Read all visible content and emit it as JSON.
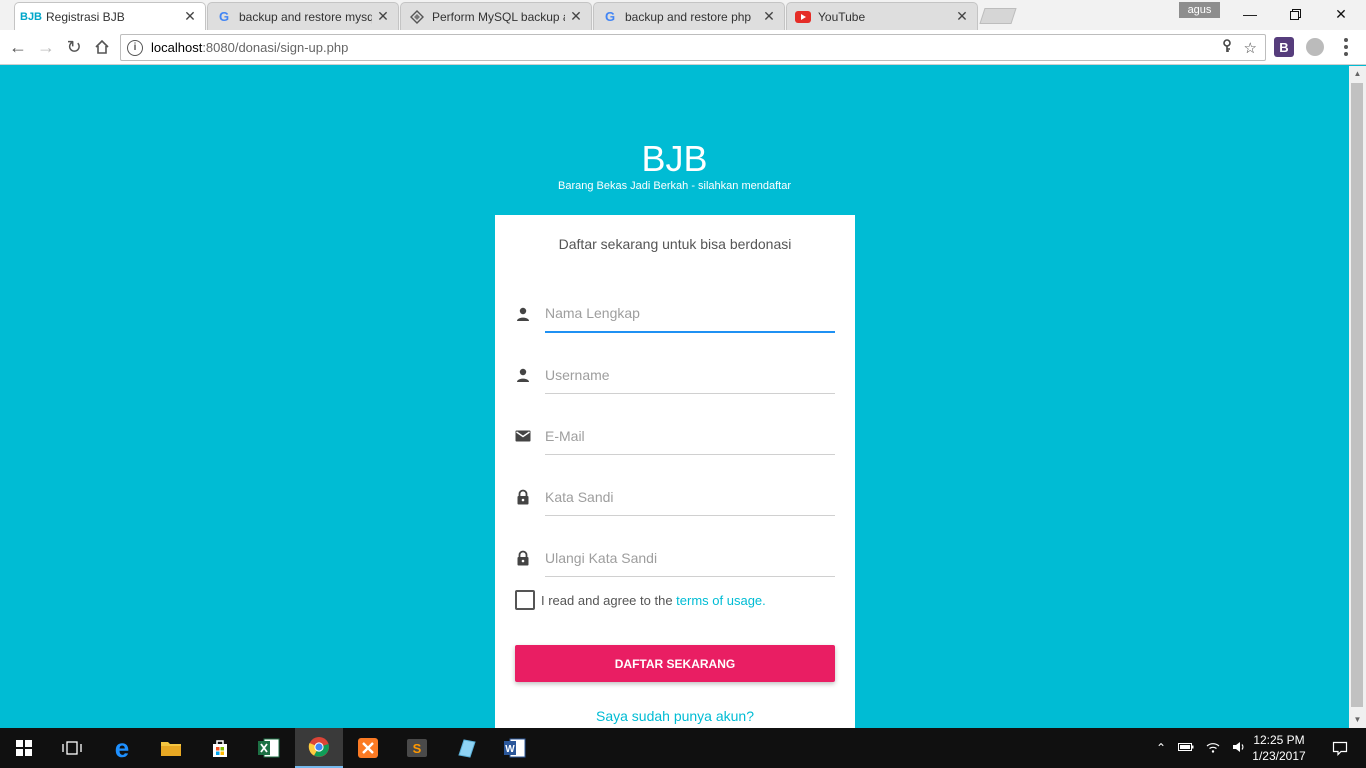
{
  "browser": {
    "tabs": [
      {
        "title": "Registrasi BJB",
        "favicon": "bjb-logo-icon"
      },
      {
        "title": "backup and restore mysql",
        "favicon": "google-icon"
      },
      {
        "title": "Perform MySQL backup and",
        "favicon": "mysql-icon"
      },
      {
        "title": "backup and restore php",
        "favicon": "google-icon"
      },
      {
        "title": "YouTube",
        "favicon": "youtube-icon"
      }
    ],
    "profile_name": "agus",
    "url_host": "localhost",
    "url_rest": ":8080/donasi/sign-up.php"
  },
  "page": {
    "brand": "BJB",
    "tagline": "Barang Bekas Jadi Berkah - silahkan mendaftar",
    "intro": "Daftar sekarang untuk bisa berdonasi",
    "fields": [
      {
        "placeholder": "Nama Lengkap",
        "icon": "person-icon"
      },
      {
        "placeholder": "Username",
        "icon": "person-icon"
      },
      {
        "placeholder": "E-Mail",
        "icon": "email-icon"
      },
      {
        "placeholder": "Kata Sandi",
        "icon": "lock-icon"
      },
      {
        "placeholder": "Ulangi Kata Sandi",
        "icon": "lock-icon"
      }
    ],
    "agree_text": "I read and agree to the ",
    "terms_link": "terms of usage",
    "terms_period": ".",
    "submit_label": "DAFTAR SEKARANG",
    "login_link": "Saya sudah punya akun?"
  },
  "taskbar": {
    "time": "12:25 PM",
    "date": "1/23/2017"
  },
  "colors": {
    "background": "#00bcd4",
    "submit": "#e91e63",
    "focus_underline": "#1f91f3",
    "link": "#00bcd4"
  }
}
